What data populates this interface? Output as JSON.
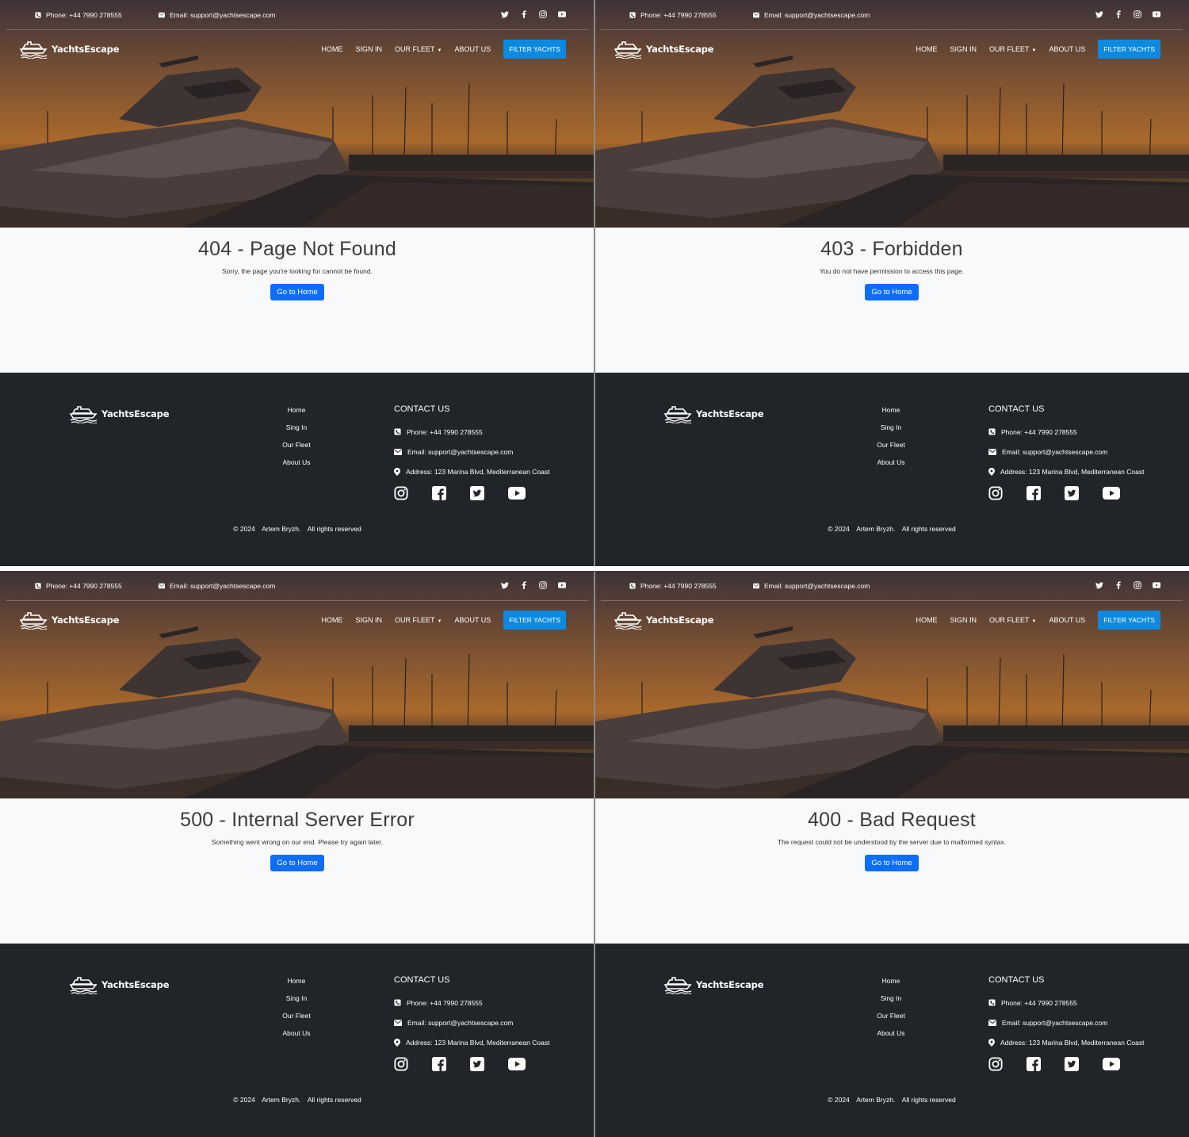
{
  "topbar": {
    "phone": "Phone: +44 7990 278555",
    "email": "Email: support@yachtsescape.com",
    "social_icons": [
      "twitter-icon",
      "facebook-icon",
      "instagram-icon",
      "youtube-icon"
    ]
  },
  "brand": {
    "name": "YachtsEscape"
  },
  "nav": {
    "home": "HOME",
    "signin": "SIGN IN",
    "fleet": "OUR FLEET",
    "about": "ABOUT US",
    "filter": "FILTER YACHTS"
  },
  "errors": [
    {
      "title": "404 - Page Not Found",
      "message": "Sorry, the page you're looking for cannot be found.",
      "button": "Go to Home"
    },
    {
      "title": "403 - Forbidden",
      "message": "You do not have permission to access this page.",
      "button": "Go to Home"
    },
    {
      "title": "500 - Internal Server Error",
      "message": "Something went wrong on our end. Please try again later.",
      "button": "Go to Home"
    },
    {
      "title": "400 - Bad Request",
      "message": "The request could not be understood by the server due to malformed syntax.",
      "button": "Go to Home"
    }
  ],
  "footer": {
    "links": [
      "Home",
      "Sing In",
      "Our Fleet",
      "About Us"
    ],
    "contact_heading": "CONTACT US",
    "phone": "Phone: +44 7990 278555",
    "email": "Email: support@yachtsescape.com",
    "address": "Address: 123 Marina Blvd, Mediterranean Coast",
    "social_icons": [
      "instagram-icon",
      "facebook-icon",
      "twitter-icon",
      "youtube-icon"
    ],
    "copyright_year": "© 2024",
    "copyright_name": "Artem Bryzh.",
    "copyright_rights": "All rights reserved"
  },
  "colors": {
    "accent": "#0d6efd",
    "filter_button": "#0d8ae0",
    "footer_bg": "#212529",
    "page_bg": "#f8f9fa"
  }
}
